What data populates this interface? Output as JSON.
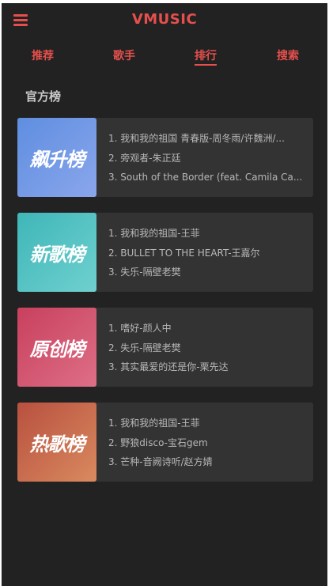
{
  "header": {
    "title": "VMUSIC",
    "menu_icon": "hamburger-menu-icon"
  },
  "nav": {
    "tabs": [
      {
        "label": "推荐",
        "active": false
      },
      {
        "label": "歌手",
        "active": false
      },
      {
        "label": "排行",
        "active": true
      },
      {
        "label": "搜索",
        "active": false
      }
    ]
  },
  "section": {
    "title": "官方榜"
  },
  "charts": [
    {
      "cover_text": "飙升榜",
      "cover_gradient": [
        "#5f8ee0",
        "#8aa6ec"
      ],
      "tracks": [
        "1. 我和我的祖国 青春版-周冬雨/许魏洲/...",
        "2. 旁观者-朱正廷",
        "3. South of the Border (feat. Camila Ca..."
      ]
    },
    {
      "cover_text": "新歌榜",
      "cover_gradient": [
        "#3fb6b8",
        "#6fd0cf"
      ],
      "tracks": [
        "1. 我和我的祖国-王菲",
        "2. BULLET TO THE HEART-王嘉尔",
        "3. 失乐-隔壁老樊"
      ]
    },
    {
      "cover_text": "原创榜",
      "cover_gradient": [
        "#c8405e",
        "#de6f86"
      ],
      "tracks": [
        "1. 嗜好-颜人中",
        "2. 失乐-隔壁老樊",
        "3. 其实最爱的还是你-栗先达"
      ]
    },
    {
      "cover_text": "热歌榜",
      "cover_gradient": [
        "#b8503f",
        "#d98a5f"
      ],
      "tracks": [
        "1. 我和我的祖国-王菲",
        "2. 野狼disco-宝石gem",
        "3. 芒种-音阙诗听/赵方婧"
      ]
    }
  ]
}
